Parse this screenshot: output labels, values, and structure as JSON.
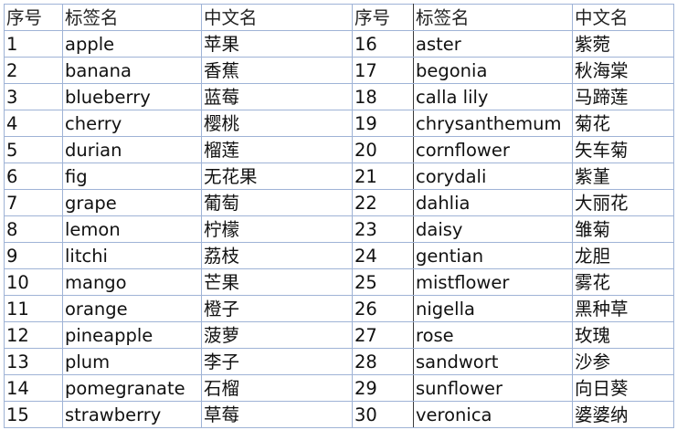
{
  "headers": [
    "序号",
    "标签名",
    "中文名",
    "序号",
    "标签名",
    "中文名"
  ],
  "rows": [
    [
      "1",
      "apple",
      "苹果",
      "16",
      "aster",
      "紫菀"
    ],
    [
      "2",
      "banana",
      "香蕉",
      "17",
      "begonia",
      "秋海棠"
    ],
    [
      "3",
      "blueberry",
      "蓝莓",
      "18",
      "calla lily",
      "马蹄莲"
    ],
    [
      "4",
      "cherry",
      "樱桃",
      "19",
      "chrysanthemum",
      "菊花"
    ],
    [
      "5",
      "durian",
      "榴莲",
      "20",
      "cornflower",
      "矢车菊"
    ],
    [
      "6",
      "fig",
      "无花果",
      "21",
      "corydali",
      "紫堇"
    ],
    [
      "7",
      "grape",
      "葡萄",
      "22",
      "dahlia",
      "大丽花"
    ],
    [
      "8",
      "lemon",
      "柠檬",
      "23",
      "daisy",
      "雏菊"
    ],
    [
      "9",
      "litchi",
      "荔枝",
      "24",
      "gentian",
      "龙胆"
    ],
    [
      "10",
      "mango",
      "芒果",
      "25",
      "mistflower",
      "雾花"
    ],
    [
      "11",
      "orange",
      "橙子",
      "26",
      "nigella",
      "黑种草"
    ],
    [
      "12",
      "pineapple",
      "菠萝",
      "27",
      "rose",
      "玫瑰"
    ],
    [
      "13",
      "plum",
      "李子",
      "28",
      "sandwort",
      "沙参"
    ],
    [
      "14",
      "pomegranate",
      "石榴",
      "29",
      "sunflower",
      "向日葵"
    ],
    [
      "15",
      "strawberry",
      "草莓",
      "30",
      "veronica",
      "婆婆纳"
    ]
  ]
}
